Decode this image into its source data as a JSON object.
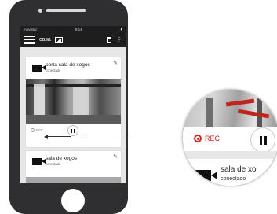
{
  "statusbar": {
    "carrier": "movistar",
    "time": "9:14"
  },
  "appbar": {
    "title": "casa"
  },
  "cameras": [
    {
      "name": "porta sala de xogos",
      "status": "conectado"
    },
    {
      "name": "sala de xogos",
      "status": "conectado"
    }
  ],
  "controls": {
    "rec_label": "REC"
  },
  "magnifier": {
    "rec_label": "REC",
    "camera_name": "sala de xo",
    "camera_status": "conectado"
  },
  "colors": {
    "rec_red": "#d9251c",
    "phone_body": "#2f2f31",
    "appbar": "#1e1e1e"
  }
}
